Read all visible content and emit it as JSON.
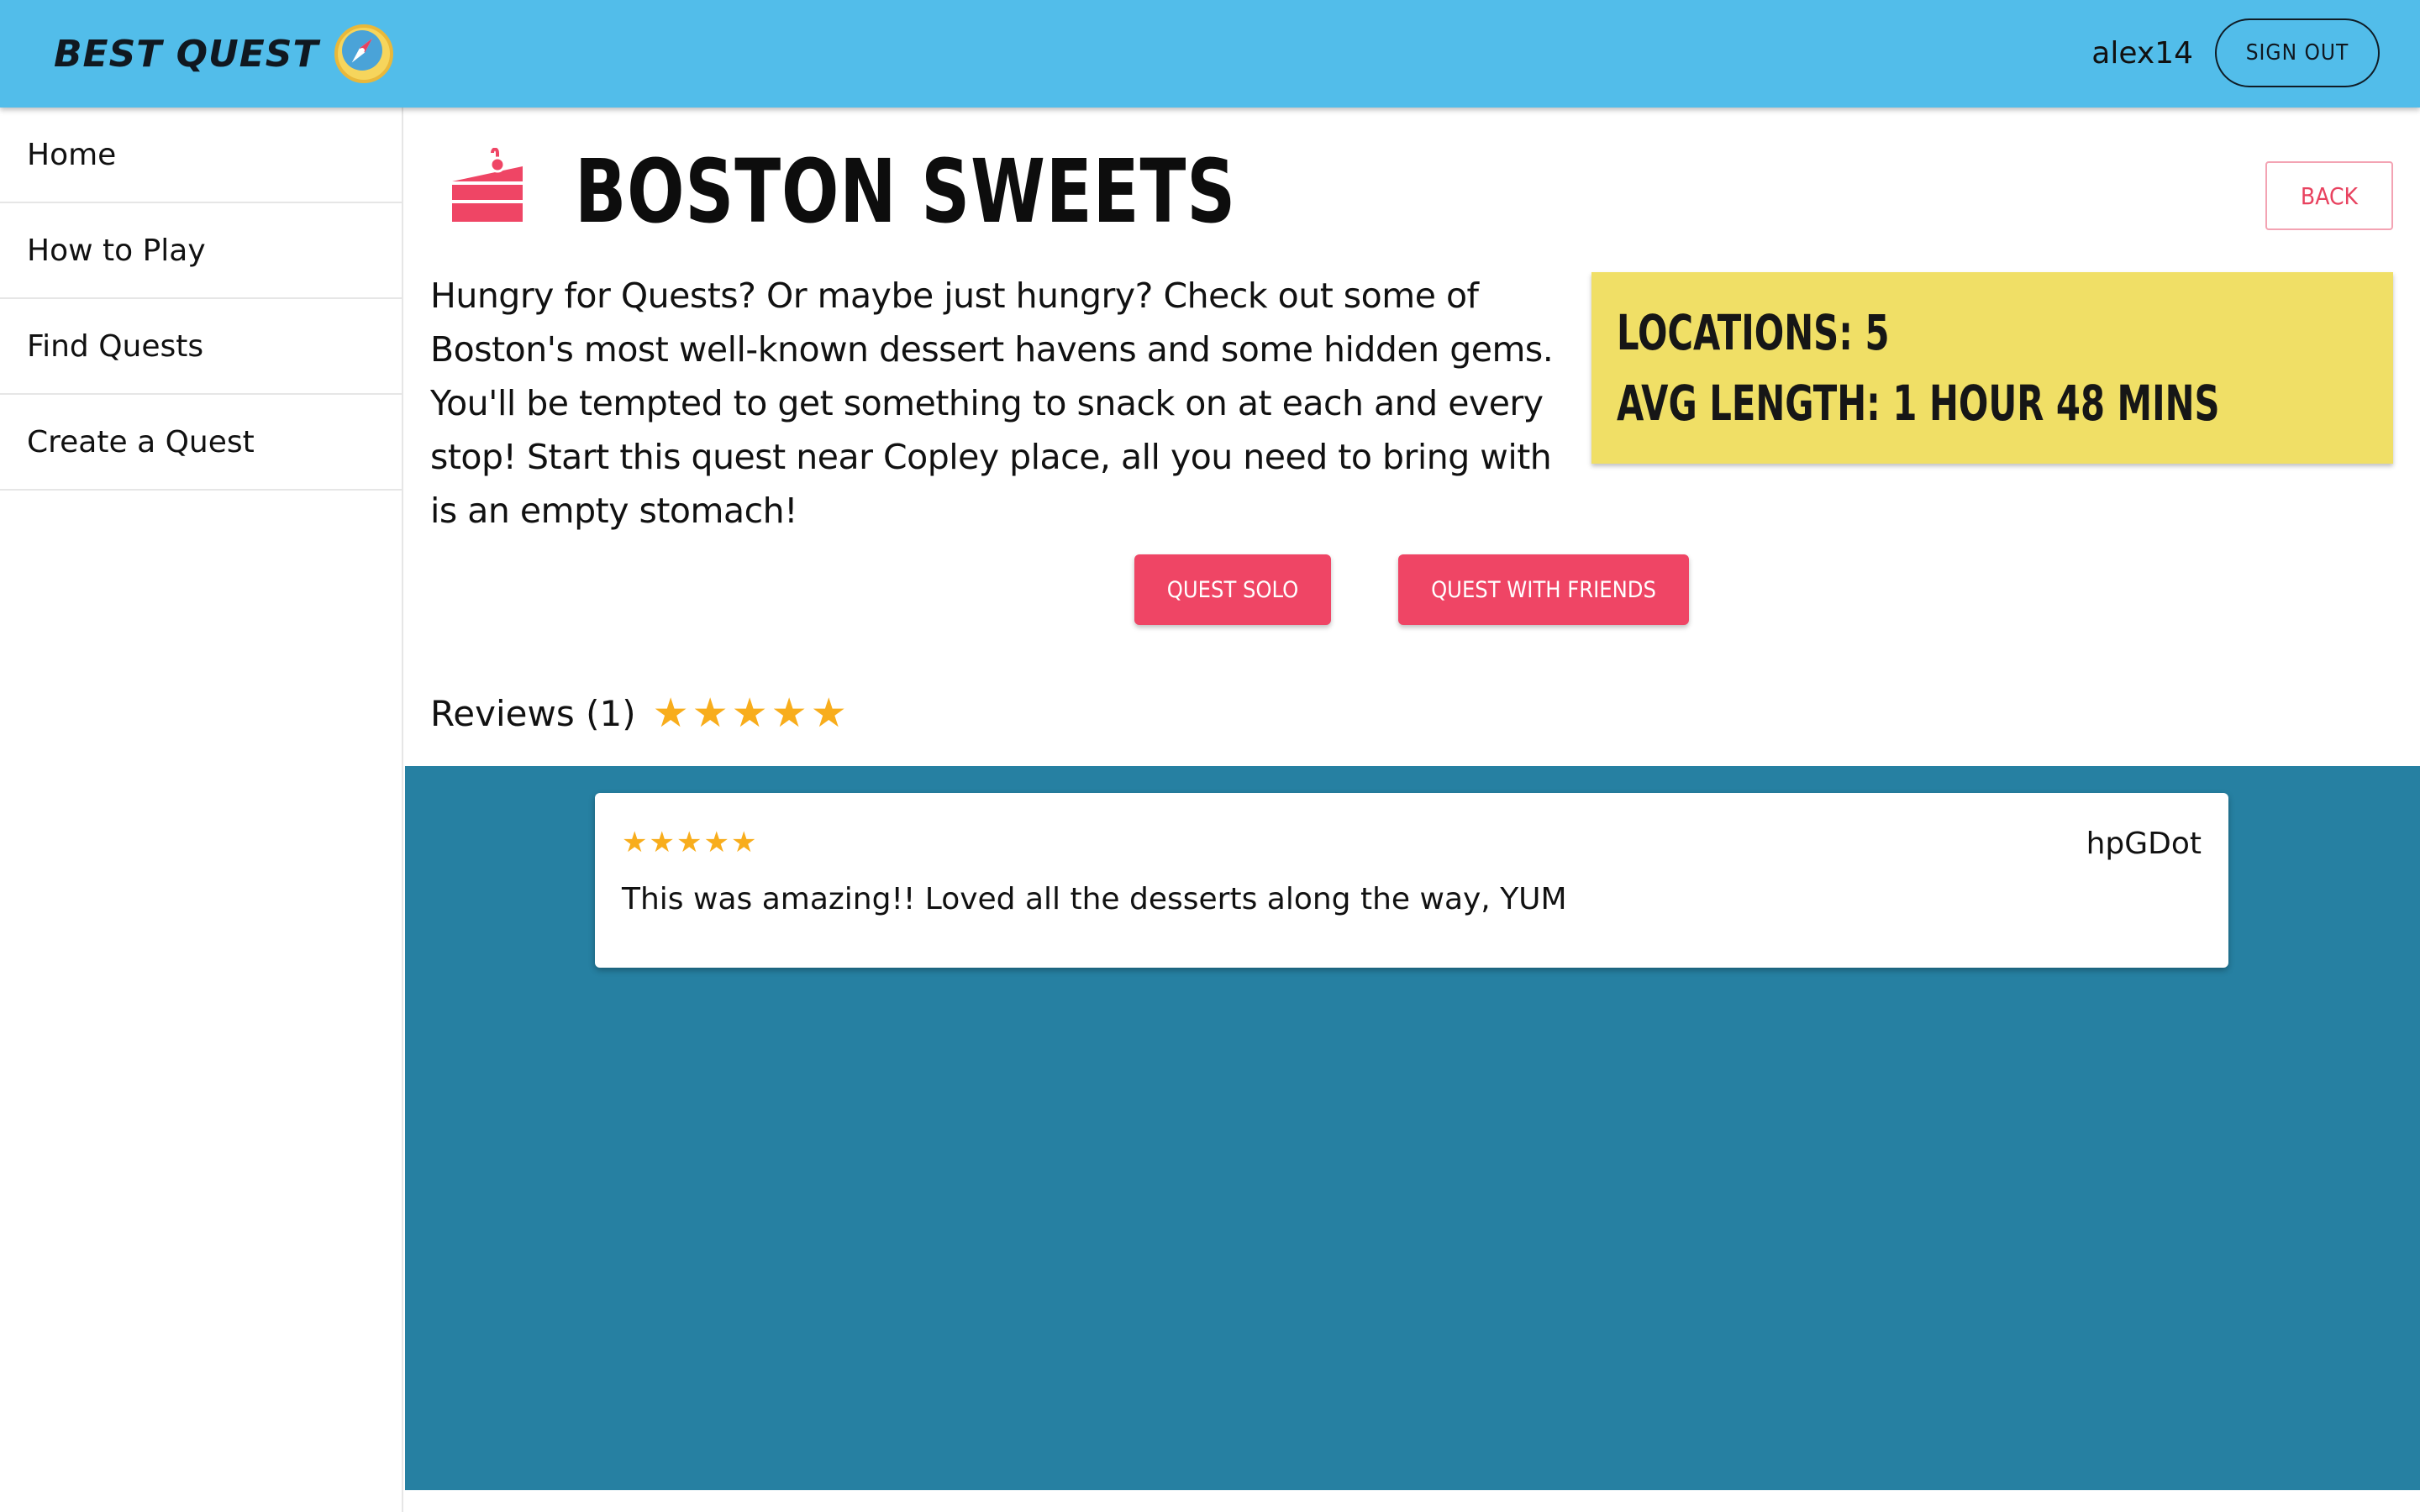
{
  "header": {
    "brand": "BEST QUEST",
    "username": "alex14",
    "signout_label": "SIGN OUT",
    "background_color": "#52bdea"
  },
  "sidebar": {
    "items": [
      {
        "label": "Home"
      },
      {
        "label": "How to Play"
      },
      {
        "label": "Find Quests"
      },
      {
        "label": "Create a Quest"
      }
    ]
  },
  "quest": {
    "icon": "cake-icon",
    "title": "BOSTON SWEETS",
    "back_label": "BACK",
    "description": "Hungry for Quests? Or maybe just hungry? Check out some of Boston's most well-known dessert havens and some hidden gems. You'll be tempted to get something to snack on at each and every stop! Start this quest near Copley place, all you need to bring with is an empty stomach!",
    "stats": {
      "locations": "LOCATIONS: 5",
      "avg_length": "AVG LENGTH: 1 HOUR 48 MINS"
    },
    "actions": {
      "solo_label": "QUEST SOLO",
      "friends_label": "QUEST WITH FRIENDS"
    }
  },
  "reviews": {
    "heading": "Reviews (1)",
    "rating": 5,
    "items": [
      {
        "user": "hpGDot",
        "rating": 5,
        "text": "This was amazing!! Loved all the desserts along the way, YUM"
      }
    ]
  },
  "colors": {
    "accent": "#ef4565",
    "stats_background": "#f0df66",
    "reviews_background": "#2680a2",
    "star": "#f8ad1c"
  }
}
